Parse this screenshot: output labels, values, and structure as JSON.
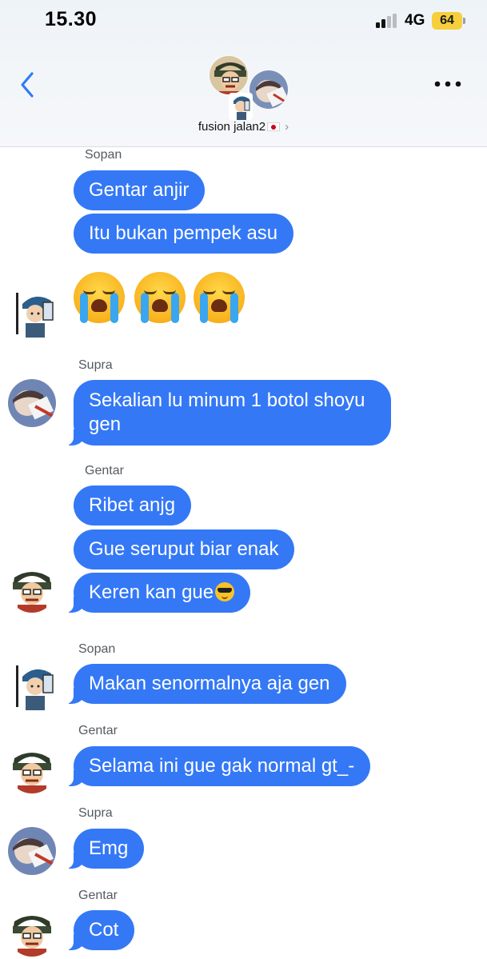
{
  "status_bar": {
    "time": "15.30",
    "network": "4G",
    "battery": "64"
  },
  "header": {
    "group_name": "fusion jalan2",
    "back_icon": "chevron-left-icon",
    "more_icon": "ellipsis-icon"
  },
  "colors": {
    "bubble": "#3478f6",
    "accent": "#3478f6",
    "battery": "#f7cf3c"
  },
  "messages": [
    {
      "sender": "Sopan",
      "text": "Gentar anjir"
    },
    {
      "sender": "Sopan",
      "text": "Itu bukan pempek asu"
    },
    {
      "sender": "Sopan",
      "text": "😭 😭 😭",
      "emoji_only": true
    },
    {
      "sender": "Supra",
      "text": "Sekalian lu minum 1 botol shoyu gen"
    },
    {
      "sender": "Gentar",
      "text": "Ribet anjg"
    },
    {
      "sender": "Gentar",
      "text": "Gue seruput biar enak"
    },
    {
      "sender": "Gentar",
      "text": "Keren kan gue",
      "emoji": "smiling-face-with-sunglasses"
    },
    {
      "sender": "Sopan",
      "text": "Makan senormalnya aja gen"
    },
    {
      "sender": "Gentar",
      "text": "Selama ini gue gak normal gt_-"
    },
    {
      "sender": "Supra",
      "text": "Emg"
    },
    {
      "sender": "Gentar",
      "text": "Cot"
    }
  ]
}
